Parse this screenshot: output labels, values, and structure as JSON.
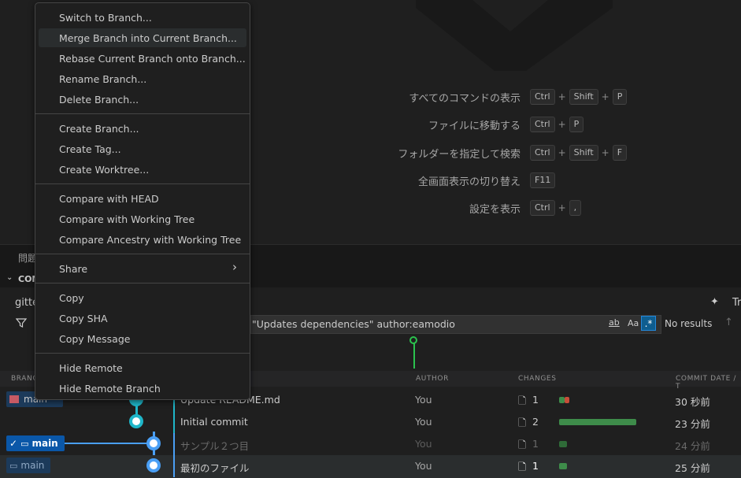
{
  "editor": {
    "commands": [
      {
        "label": "すべてのコマンドの表示",
        "keys": [
          "Ctrl",
          "Shift",
          "P"
        ]
      },
      {
        "label": "ファイルに移動する",
        "keys": [
          "Ctrl",
          "P"
        ]
      },
      {
        "label": "フォルダーを指定して検索",
        "keys": [
          "Ctrl",
          "Shift",
          "F"
        ]
      },
      {
        "label": "全画面表示の切り替え",
        "keys": [
          "F11"
        ]
      },
      {
        "label": "設定を表示",
        "keys": [
          "Ctrl",
          ","
        ]
      }
    ]
  },
  "panel": {
    "tab_problems": "問題",
    "section_title": "COM"
  },
  "graph": {
    "repo": "gitte",
    "search_query": "\"Updates dependencies\" author:eamodio",
    "no_results": "No results",
    "tr": "Tr",
    "opt_ab": "ab",
    "opt_aa": "Aa",
    "columns": {
      "branch": "BRANCH",
      "author": "AUTHOR",
      "changes": "CHANGES",
      "commit_date": "COMMIT DATE / T"
    },
    "rows": [
      {
        "branch": "main",
        "message": "Update README.md",
        "author": "You",
        "files": "1",
        "date": "30 秒前"
      },
      {
        "branch": "",
        "message": "Initial commit",
        "author": "You",
        "files": "2",
        "date": "23 分前"
      },
      {
        "branch": "main",
        "message": "サンプル２つ目",
        "author": "You",
        "files": "1",
        "date": "24 分前"
      },
      {
        "branch": "main",
        "message": "最初のファイル",
        "author": "You",
        "files": "1",
        "date": "25 分前"
      }
    ]
  },
  "menu": {
    "items": [
      "Switch to Branch...",
      "Merge Branch into Current Branch...",
      "Rebase Current Branch onto Branch...",
      "Rename Branch...",
      "Delete Branch...",
      "Create Branch...",
      "Create Tag...",
      "Create Worktree...",
      "Compare with HEAD",
      "Compare with Working Tree",
      "Compare Ancestry with Working Tree",
      "Share",
      "Copy",
      "Copy SHA",
      "Copy Message",
      "Hide Remote",
      "Hide Remote Branch"
    ],
    "share_arrow": "›"
  },
  "colors": {
    "accent": "#0078d4",
    "selected_badge": "#0a57a8",
    "remote_badge": "#1c3a5a",
    "graph_blue": "#4a9ff5",
    "graph_teal": "#1fb6c9",
    "graph_green": "#2bc24e"
  }
}
